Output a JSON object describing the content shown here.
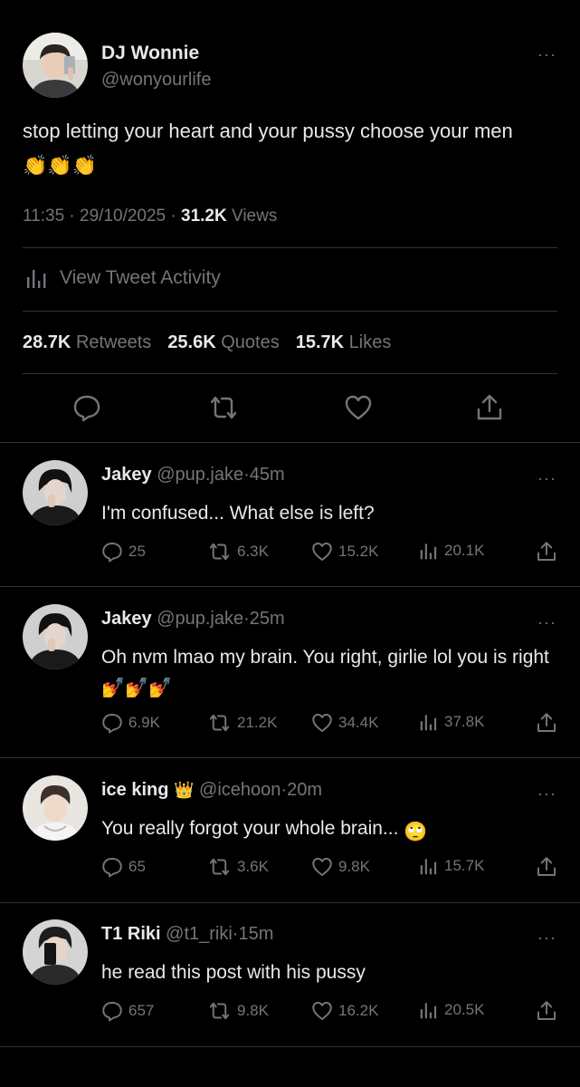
{
  "tweet": {
    "author_name": "DJ Wonnie",
    "author_handle": "@wonyourlife",
    "text": "stop letting your heart and your pussy choose your men",
    "emoji": "👏👏👏",
    "time": "11:35",
    "date": "29/10/2025",
    "sep": "·",
    "views_count": "31.2K",
    "views_label": "Views",
    "activity_label": "View Tweet Activity",
    "retweets_count": "28.7K",
    "retweets_label": "Retweets",
    "quotes_count": "25.6K",
    "quotes_label": "Quotes",
    "likes_count": "15.7K",
    "likes_label": "Likes",
    "more": "···"
  },
  "icons": {
    "reply": "reply-icon",
    "retweet": "retweet-icon",
    "like": "heart-icon",
    "share": "share-icon",
    "views": "bar-chart-icon"
  },
  "colors": {
    "background": "#000000",
    "text": "#e7e9ea",
    "muted": "#71767b",
    "divider": "#2f3336"
  },
  "replies": [
    {
      "name": "Jakey",
      "handle": "@pup.jake",
      "time": "45m",
      "text": "I'm confused... What else is left?",
      "replies": "25",
      "retweets": "6.3K",
      "likes": "15.2K",
      "views": "20.1K"
    },
    {
      "name": "Jakey",
      "handle": "@pup.jake",
      "time": "25m",
      "text": "Oh nvm lmao my brain. You right, girlie lol you is right",
      "emoji": "💅💅💅",
      "replies": "6.9K",
      "retweets": "21.2K",
      "likes": "34.4K",
      "views": "37.8K"
    },
    {
      "name": "ice king",
      "name_emoji": "👑",
      "handle": "@icehoon",
      "time": "20m",
      "text": "You really forgot your whole brain...",
      "emoji": "🙄",
      "replies": "65",
      "retweets": "3.6K",
      "likes": "9.8K",
      "views": "15.7K"
    },
    {
      "name": "T1 Riki",
      "handle": "@t1_riki",
      "time": "15m",
      "text": "he read this post with his pussy",
      "replies": "657",
      "retweets": "9.8K",
      "likes": "16.2K",
      "views": "20.5K"
    }
  ]
}
